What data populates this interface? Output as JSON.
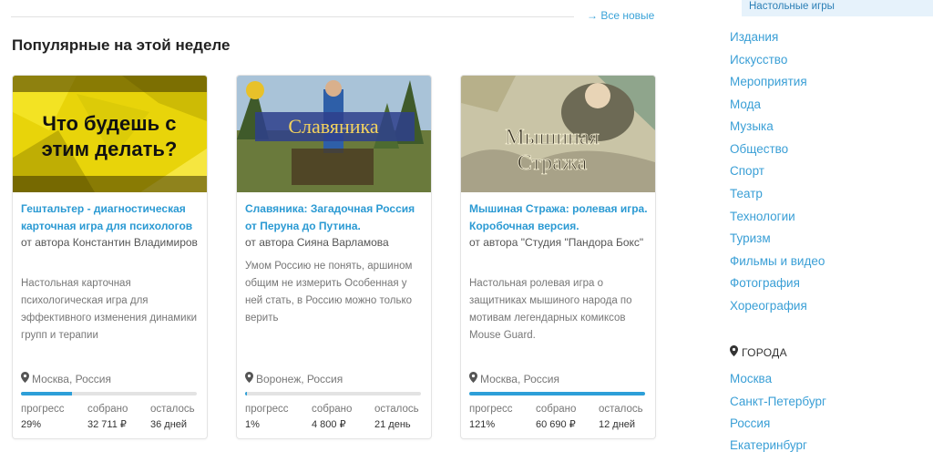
{
  "header": {
    "all_new": "→ Все новые",
    "section_title": "Популярные на этой неделе"
  },
  "cards": [
    {
      "title": "Гештальтер - диагностическая карточная игра для психологов",
      "author": "от автора Константин Владимиров",
      "desc": "Настольная карточная психологическая игра для эффективного изменения динамики групп и терапии",
      "location": "Москва, Россия",
      "progress": 29,
      "labels": [
        "прогресс",
        "собрано",
        "осталось"
      ],
      "values": [
        "29%",
        "32 711 ₽",
        "36 дней"
      ],
      "image_text": "Что будешь с этим делать?"
    },
    {
      "title": "Славяника: Загадочная Россия от Перуна до Путина.",
      "author": "от автора Сияна Варламова",
      "desc": "Умом Россию не понять, аршином общим не измерить Особенная у ней стать, в Россию можно только верить",
      "location": "Воронеж, Россия",
      "progress": 1,
      "labels": [
        "прогресс",
        "собрано",
        "осталось"
      ],
      "values": [
        "1%",
        "4 800 ₽",
        "21 день"
      ],
      "image_text": "Славяника"
    },
    {
      "title": "Мышиная Стража: ролевая игра. Коробочная версия.",
      "author": "от автора \"Студия \"Пандора Бокс\"",
      "desc": "Настольная ролевая игра о защитниках мышиного народа по мотивам легендарных комиксов Mouse Guard.",
      "location": "Москва, Россия",
      "progress": 121,
      "labels": [
        "прогресс",
        "собрано",
        "осталось"
      ],
      "values": [
        "121%",
        "60 690 ₽",
        "12 дней"
      ],
      "image_text": "Мышиная Стража"
    }
  ],
  "sidebar": {
    "active_category": "Настольные игры",
    "categories": [
      "Издания",
      "Искусство",
      "Мероприятия",
      "Мода",
      "Музыка",
      "Общество",
      "Спорт",
      "Театр",
      "Технологии",
      "Туризм",
      "Фильмы и видео",
      "Фотография",
      "Хореография"
    ],
    "cities_heading": "ГОРОДА",
    "cities": [
      "Москва",
      "Санкт-Петербург",
      "Россия",
      "Екатеринбург"
    ]
  },
  "icons": {
    "location": "location-pin-icon",
    "cities": "location-pin-icon"
  },
  "colors": {
    "accent": "#2d9fd8",
    "link": "#3a9fd6"
  }
}
